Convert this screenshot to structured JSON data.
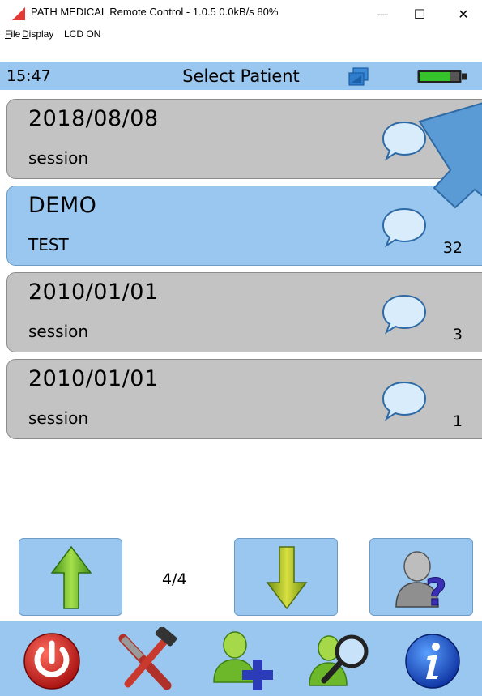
{
  "window": {
    "title": "PATH MEDICAL Remote Control  -  1.0.5  0.0kB/s 80%",
    "controls": {
      "minimize": "—",
      "maximize": "☐",
      "close": "✕"
    }
  },
  "menu": [
    {
      "mnemonic": "F",
      "rest": "ile"
    },
    {
      "mnemonic": "D",
      "rest": "isplay"
    },
    {
      "mnemonic": "",
      "rest": "LCD ON"
    }
  ],
  "status": {
    "time": "15:47",
    "title": "Select Patient"
  },
  "patients": [
    {
      "name": "2018/08/08",
      "sub": "session",
      "count": "",
      "selected": false
    },
    {
      "name": "DEMO",
      "sub": "TEST",
      "count": "32",
      "selected": true
    },
    {
      "name": "2010/01/01",
      "sub": "session",
      "count": "3",
      "selected": false
    },
    {
      "name": "2010/01/01",
      "sub": "session",
      "count": "1",
      "selected": false
    }
  ],
  "pager": {
    "page": "4/4"
  },
  "icons": {
    "up": "arrow-up-icon",
    "down": "arrow-down-icon",
    "help": "user-help-icon",
    "power": "power-icon",
    "tools": "tools-icon",
    "add_patient": "add-user-icon",
    "search_patient": "search-user-icon",
    "info": "info-icon"
  },
  "colors": {
    "bar_blue": "#99c7ef",
    "item_gray": "#c3c3c3",
    "callout_blue": "#5b9bd5",
    "arrow_green": "#6fbf2a"
  }
}
